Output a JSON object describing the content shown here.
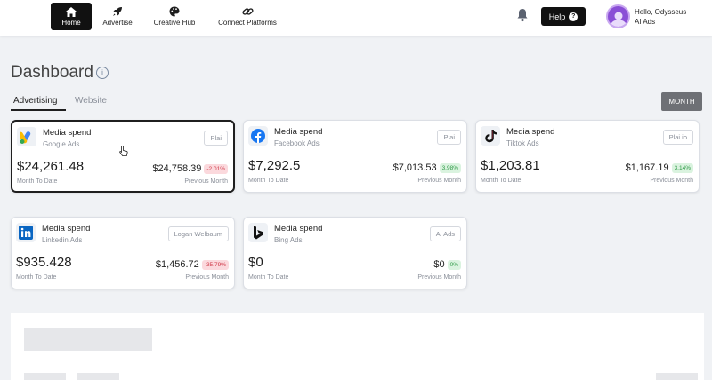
{
  "nav": {
    "items": [
      {
        "label": "Home",
        "icon": "home-icon"
      },
      {
        "label": "Advertise",
        "icon": "rocket-icon"
      },
      {
        "label": "Creative Hub",
        "icon": "palette-icon"
      },
      {
        "label": "Connect Platforms",
        "icon": "link-icon"
      }
    ],
    "help_label": "Help",
    "help_icon": "?",
    "user_greeting": "Hello, Odysseus",
    "user_company": "AI Ads"
  },
  "page": {
    "title": "Dashboard",
    "info_icon": "i",
    "tabs": [
      "Advertising",
      "Website"
    ],
    "period_button": "MONTH"
  },
  "cards": [
    {
      "title": "Media spend",
      "platform": "Google Ads",
      "tag": "Plai",
      "value": "$24,261.48",
      "value_label": "Month To Date",
      "prev_value": "$24,758.39",
      "change": "-2.01%",
      "change_dir": "negative",
      "prev_label": "Previous Month"
    },
    {
      "title": "Media spend",
      "platform": "Facebook Ads",
      "tag": "Plai",
      "value": "$7,292.5",
      "value_label": "Month To Date",
      "prev_value": "$7,013.53",
      "change": "3.98%",
      "change_dir": "positive",
      "prev_label": "Previous Month"
    },
    {
      "title": "Media spend",
      "platform": "Tiktok Ads",
      "tag": "Plai.io",
      "value": "$1,203.81",
      "value_label": "Month To Date",
      "prev_value": "$1,167.19",
      "change": "3.14%",
      "change_dir": "positive",
      "prev_label": "Previous Month"
    },
    {
      "title": "Media spend",
      "platform": "Linkedin Ads",
      "tag": "Logan Welbaum",
      "value": "$935.428",
      "value_label": "Month To Date",
      "prev_value": "$1,456.72",
      "change": "-35.79%",
      "change_dir": "negative",
      "prev_label": "Previous Month"
    },
    {
      "title": "Media spend",
      "platform": "Bing Ads",
      "tag": "Ai Ads",
      "value": "$0",
      "value_label": "Month To Date",
      "prev_value": "$0",
      "change": "0%",
      "change_dir": "positive",
      "prev_label": "Previous Month"
    }
  ],
  "colors": {
    "accent_dark": "#111111",
    "negative": "#d03b4a",
    "positive": "#2f9a47",
    "google_blue": "#4285F4",
    "google_yellow": "#FBBC04",
    "facebook_blue": "#1877F2",
    "linkedin_blue": "#0A66C2",
    "avatar_purple": "#8a4fd6"
  }
}
